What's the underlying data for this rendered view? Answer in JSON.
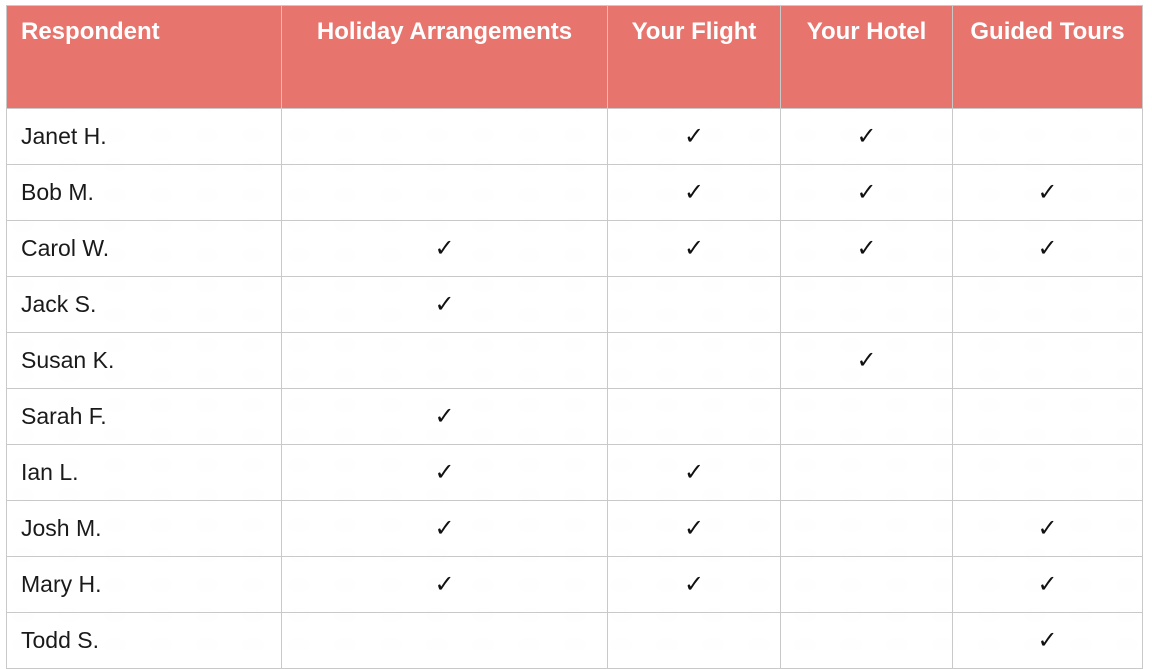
{
  "table": {
    "headers": [
      "Respondent",
      "Holiday Arrangements",
      "Your Flight",
      "Your Hotel",
      "Guided Tours"
    ],
    "check_glyph": "✓",
    "rows": [
      {
        "name": "Janet H.",
        "holiday": "",
        "flight": "✓",
        "hotel": "✓",
        "tours": ""
      },
      {
        "name": "Bob M.",
        "holiday": "",
        "flight": "✓",
        "hotel": "✓",
        "tours": "✓"
      },
      {
        "name": "Carol W.",
        "holiday": "✓",
        "flight": "✓",
        "hotel": "✓",
        "tours": "✓"
      },
      {
        "name": "Jack S.",
        "holiday": "✓",
        "flight": "",
        "hotel": "",
        "tours": ""
      },
      {
        "name": "Susan K.",
        "holiday": "",
        "flight": "",
        "hotel": "✓",
        "tours": ""
      },
      {
        "name": "Sarah F.",
        "holiday": "✓",
        "flight": "",
        "hotel": "",
        "tours": ""
      },
      {
        "name": "Ian L.",
        "holiday": "✓",
        "flight": "✓",
        "hotel": "",
        "tours": ""
      },
      {
        "name": "Josh M.",
        "holiday": "✓",
        "flight": "✓",
        "hotel": "",
        "tours": "✓"
      },
      {
        "name": "Mary H.",
        "holiday": "✓",
        "flight": "✓",
        "hotel": "",
        "tours": "✓"
      },
      {
        "name": "Todd S.",
        "holiday": "",
        "flight": "",
        "hotel": "",
        "tours": "✓"
      }
    ]
  },
  "colors": {
    "header_bg": "#e8746e",
    "header_text": "#ffffff",
    "grid": "#c9c9c9"
  }
}
